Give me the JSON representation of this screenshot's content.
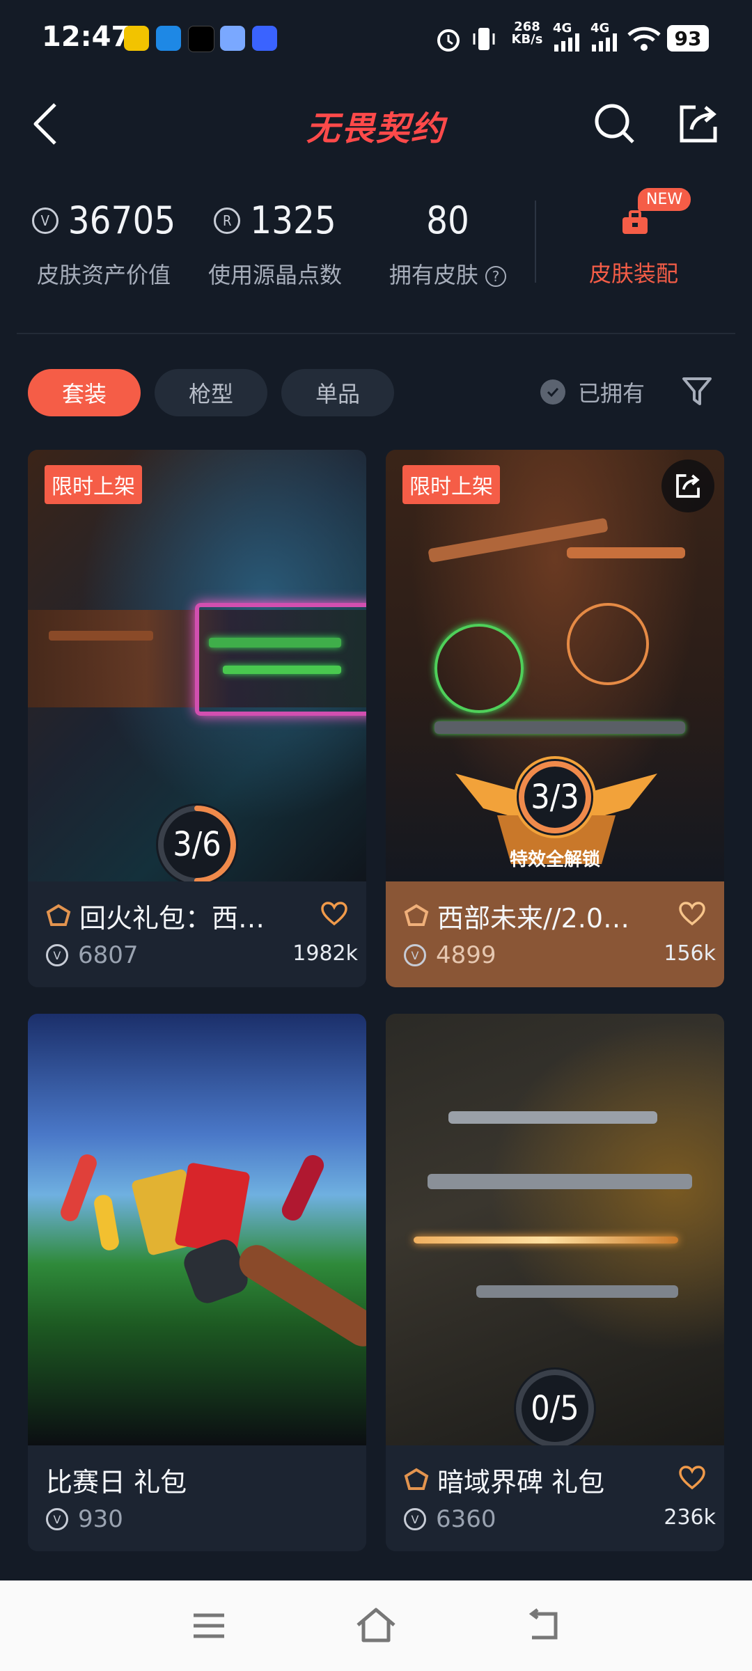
{
  "status_bar": {
    "time": "12:47",
    "net_speed": "268 KB/s",
    "signal_1": "4G",
    "signal_2": "4G",
    "battery": "93"
  },
  "header": {
    "title": "无畏契约",
    "back_icon": "chevron-left-icon",
    "search_icon": "search-icon",
    "share_icon": "share-icon"
  },
  "stats": [
    {
      "value": "36705",
      "label": "皮肤资产价值",
      "icon": "valorant-point-icon"
    },
    {
      "value": "1325",
      "label": "使用源晶点数",
      "icon": "radianite-icon"
    },
    {
      "value": "80",
      "label": "拥有皮肤",
      "icon": "help-icon"
    }
  ],
  "loadout": {
    "label": "皮肤装配",
    "badge": "NEW"
  },
  "filters": {
    "tabs": [
      "套装",
      "枪型",
      "单品"
    ],
    "owned_label": "已拥有"
  },
  "cards": [
    {
      "tag": "限时上架",
      "name": "回火礼包：西…",
      "price": "6807",
      "likes": "1982k",
      "progress": "3/6",
      "progress_fraction": 0.5
    },
    {
      "tag": "限时上架",
      "name": "西部未来//2.0…",
      "price": "4899",
      "likes": "156k",
      "progress": "3/3",
      "progress_fraction": 1.0,
      "unlock_label": "特效全解锁"
    },
    {
      "tag": "",
      "name": "比赛日 礼包",
      "price": "930",
      "likes": "",
      "progress": "",
      "progress_fraction": 0
    },
    {
      "tag": "",
      "name": "暗域界碑 礼包",
      "price": "6360",
      "likes": "236k",
      "progress": "0/5",
      "progress_fraction": 0
    }
  ],
  "colors": {
    "accent": "#f55d47",
    "background": "#141b26",
    "card": "#1c2431",
    "card_highlight": "#8a5636"
  }
}
